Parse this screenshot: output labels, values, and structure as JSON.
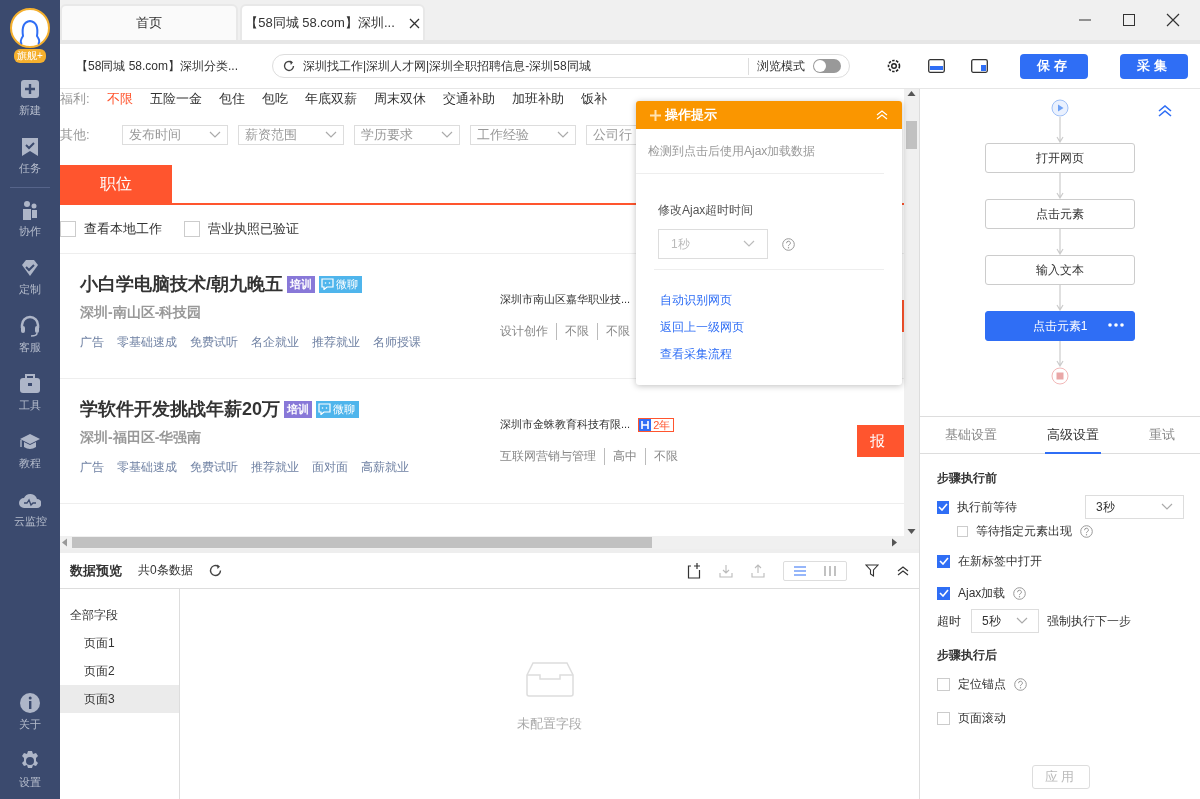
{
  "app_sidebar": {
    "logo_badge": "旗舰+",
    "items": [
      {
        "label": "新建"
      },
      {
        "label": "任务"
      }
    ],
    "group_items": [
      {
        "label": "协作"
      },
      {
        "label": "定制"
      },
      {
        "label": "客服"
      },
      {
        "label": "工具"
      },
      {
        "label": "教程"
      },
      {
        "label": "云监控"
      }
    ],
    "bottom_items": [
      {
        "label": "关于"
      },
      {
        "label": "设置"
      }
    ]
  },
  "browser_tabs": [
    {
      "label": "首页",
      "selected": false
    },
    {
      "label": "【58同城 58.com】深圳...",
      "selected": true
    }
  ],
  "address_bar": {
    "page_title": "【58同城 58.com】深圳分类...",
    "url": "深圳找工作|深圳人才网|深圳全职招聘信息-深圳58同城",
    "mode_label": "浏览模式",
    "mode_on": false
  },
  "toolbar_buttons": [
    "保存",
    "采集"
  ],
  "web_page": {
    "welfare_label": "福利:",
    "welfare": [
      {
        "label": "不限",
        "selected": true
      },
      {
        "label": "五险一金",
        "selected": false
      },
      {
        "label": "包住",
        "selected": false
      },
      {
        "label": "包吃",
        "selected": false
      },
      {
        "label": "年底双薪",
        "selected": false
      },
      {
        "label": "周末双休",
        "selected": false
      },
      {
        "label": "交通补助",
        "selected": false
      },
      {
        "label": "加班补助",
        "selected": false
      },
      {
        "label": "饭补",
        "selected": false
      }
    ],
    "other_label": "其他:",
    "filters": [
      "发布时间",
      "薪资范围",
      "学历要求",
      "工作经验",
      "公司行"
    ],
    "tab": "职位",
    "checks": [
      {
        "label": "查看本地工作",
        "checked": false
      },
      {
        "label": "营业执照已验证",
        "checked": false
      }
    ],
    "jobs": [
      {
        "title": "小白学电脑技术/朝九晚五",
        "badge": "培训",
        "chat": "微聊",
        "location": "深圳-南山区-科技园",
        "tags": [
          "广告",
          "零基础速成",
          "免费试听",
          "名企就业",
          "推荐就业",
          "名师授课"
        ],
        "company": "深圳市南山区嘉华职业技...",
        "meta": [
          "设计创作",
          "不限",
          "不限"
        ]
      },
      {
        "title": "学软件开发挑战年薪20万",
        "badge": "培训",
        "chat": "微聊",
        "location": "深圳-福田区-华强南",
        "tags": [
          "广告",
          "零基础速成",
          "免费试听",
          "推荐就业",
          "面对面",
          "高薪就业"
        ],
        "company": "深圳市金蛛教育科技有限...",
        "years": "2年",
        "meta": [
          "互联网营销与管理",
          "高中",
          "不限"
        ],
        "apply": "报"
      }
    ]
  },
  "tip_popup": {
    "title": "操作提示",
    "message": "检测到点击后使用Ajax加载数据",
    "field_label": "修改Ajax超时时间",
    "field_value": "1秒",
    "links": [
      "自动识别网页",
      "返回上一级网页",
      "查看采集流程"
    ]
  },
  "flow": {
    "steps": [
      {
        "label": "打开网页",
        "selected": false
      },
      {
        "label": "点击元素",
        "selected": false
      },
      {
        "label": "输入文本",
        "selected": false
      },
      {
        "label": "点击元素1",
        "selected": true
      }
    ]
  },
  "settings_tabs": [
    {
      "label": "基础设置",
      "selected": false
    },
    {
      "label": "高级设置",
      "selected": true
    },
    {
      "label": "重试",
      "selected": false
    }
  ],
  "settings": {
    "before_title": "步骤执行前",
    "wait": {
      "label": "执行前等待",
      "checked": true,
      "value": "3秒"
    },
    "wait_element": {
      "label": "等待指定元素出现",
      "checked": false
    },
    "new_tab": {
      "label": "在新标签中打开",
      "checked": true
    },
    "ajax": {
      "label": "Ajax加载",
      "checked": true
    },
    "timeout": {
      "label": "超时",
      "value": "5秒",
      "suffix": "强制执行下一步"
    },
    "after_title": "步骤执行后",
    "anchor": {
      "label": "定位锚点",
      "checked": false
    },
    "scroll": {
      "label": "页面滚动",
      "checked": false
    },
    "apply_button": {
      "label": "应用",
      "disabled": true
    }
  },
  "data_preview": {
    "title": "数据预览",
    "count": "共0条数据",
    "view_modes": [
      {
        "selected": true
      },
      {
        "selected": false
      }
    ],
    "tree": {
      "label": "全部字段",
      "children": [
        {
          "label": "页面1",
          "selected": false
        },
        {
          "label": "页面2",
          "selected": false
        },
        {
          "label": "页面3",
          "selected": true
        }
      ]
    },
    "empty_text": "未配置字段"
  }
}
